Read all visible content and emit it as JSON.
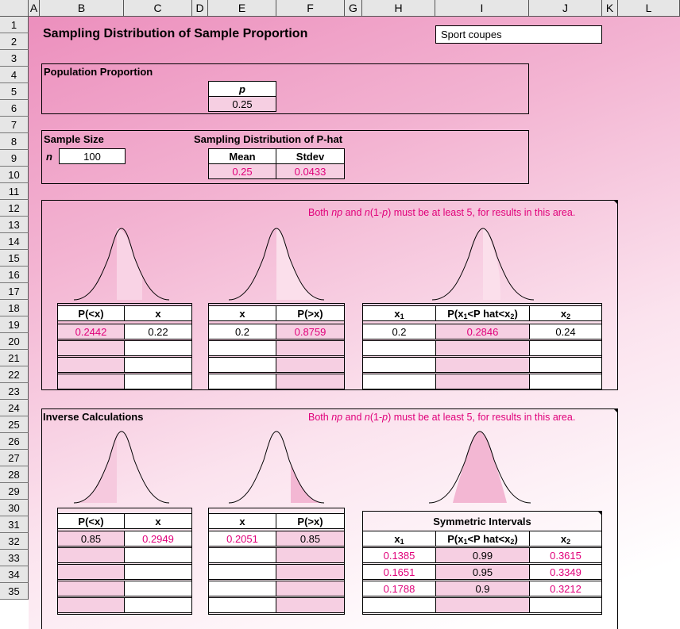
{
  "columns": [
    "A",
    "B",
    "C",
    "D",
    "E",
    "F",
    "G",
    "H",
    "I",
    "J",
    "K",
    "L"
  ],
  "rows": [
    "1",
    "2",
    "3",
    "4",
    "5",
    "6",
    "7",
    "8",
    "9",
    "10",
    "11",
    "12",
    "13",
    "14",
    "15",
    "16",
    "17",
    "18",
    "19",
    "20",
    "21",
    "22",
    "23",
    "24",
    "25",
    "26",
    "27",
    "28",
    "29",
    "30",
    "31",
    "32",
    "33",
    "34",
    "35"
  ],
  "title": "Sampling Distribution of Sample Proportion",
  "dataset_name": "Sport coupes",
  "population": {
    "label": "Population Proportion",
    "p_header": "p",
    "p_value": "0.25"
  },
  "sample": {
    "label": "Sample Size",
    "n_label": "n",
    "n_value": "100"
  },
  "sampling_dist": {
    "label": "Sampling Distribution of P-hat",
    "mean_header": "Mean",
    "stdev_header": "Stdev",
    "mean_value": "0.25",
    "stdev_value": "0.0433"
  },
  "notes": {
    "top": {
      "p1": "Both ",
      "p2": "np",
      "p3": " and ",
      "p4": "n",
      "p5": "(1-",
      "p6": "p",
      "p7": ") must be at least 5, for results in this area."
    },
    "inverse": {
      "p1": "Both ",
      "p2": "np",
      "p3": " and ",
      "p4": "n",
      "p5": "(1-",
      "p6": "p",
      "p7": ") must be at least 5, for results in this area."
    }
  },
  "inverse_label": "Inverse Calculations",
  "tables": {
    "less_than": {
      "h1": "P(<x)",
      "h2": "x",
      "p": "0.2442",
      "x": "0.22"
    },
    "greater_than": {
      "h1": "x",
      "h2": "P(>x)",
      "x": "0.2",
      "p": "0.8759"
    },
    "between": {
      "h1": "x",
      "h1_sub": "1",
      "h2a": "P(x",
      "h2_sub1": "1",
      "h2b": "<P hat<x",
      "h2_sub2": "2",
      "h2c": ")",
      "h3": "x",
      "h3_sub": "2",
      "x1": "0.2",
      "p": "0.2846",
      "x2": "0.24"
    },
    "inv_less": {
      "h1": "P(<x)",
      "h2": "x",
      "p": "0.85",
      "x": "0.2949"
    },
    "inv_greater": {
      "h1": "x",
      "h2": "P(>x)",
      "x": "0.2051",
      "p": "0.85"
    },
    "symmetric": {
      "title": "Symmetric Intervals",
      "h1": "x",
      "h1_sub": "1",
      "h2a": "P(x",
      "h2_sub1": "1",
      "h2b": "<P hat<x",
      "h2_sub2": "2",
      "h2c": ")",
      "h3": "x",
      "h3_sub": "2",
      "rows": [
        {
          "x1": "0.1385",
          "p": "0.99",
          "x2": "0.3615"
        },
        {
          "x1": "0.1651",
          "p": "0.95",
          "x2": "0.3349"
        },
        {
          "x1": "0.1788",
          "p": "0.9",
          "x2": "0.3212"
        }
      ]
    }
  },
  "colors": {
    "accent": "#e0007a",
    "input_fill": "#f6cfe2",
    "shade": "#f9d3e5"
  }
}
